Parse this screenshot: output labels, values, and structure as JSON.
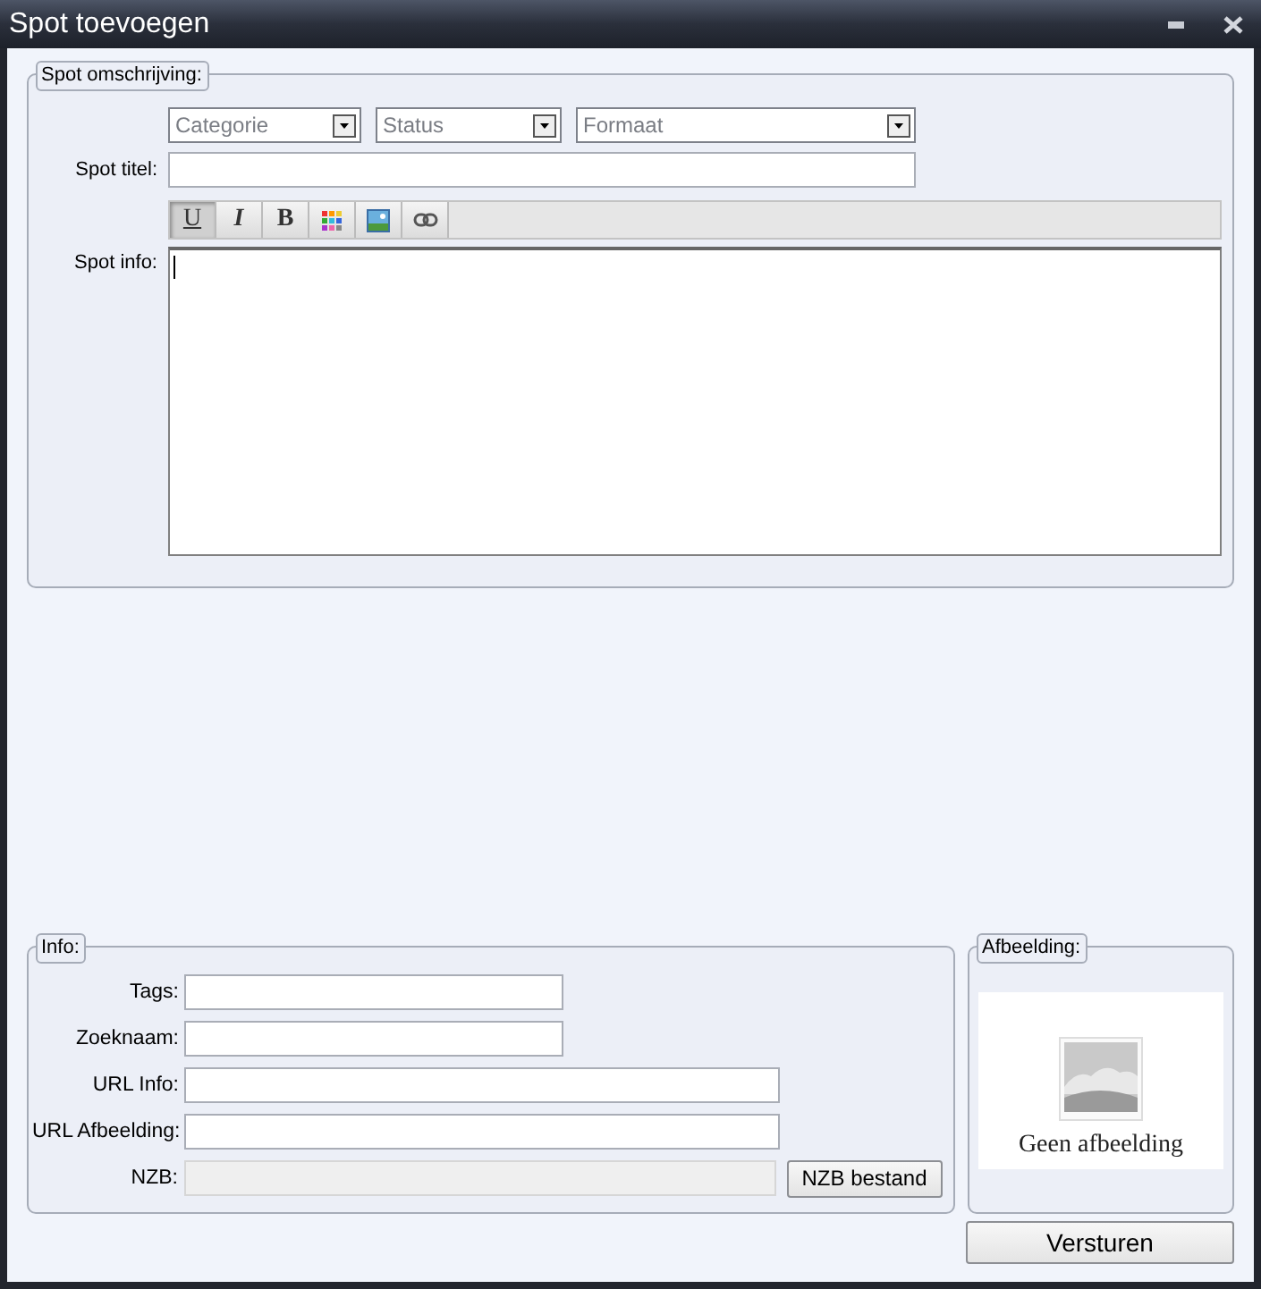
{
  "window": {
    "title": "Spot toevoegen"
  },
  "description": {
    "legend": "Spot omschrijving:",
    "dropdowns": [
      {
        "value": "Categorie"
      },
      {
        "value": "Status"
      },
      {
        "value": "Formaat"
      }
    ],
    "title_label": "Spot titel:",
    "toolbar": [
      {
        "kind": "underline",
        "label": "U",
        "selected": true
      },
      {
        "kind": "italic",
        "label": "I",
        "selected": false
      },
      {
        "kind": "bold",
        "label": "B",
        "selected": false
      },
      {
        "kind": "color"
      },
      {
        "kind": "image"
      },
      {
        "kind": "link"
      }
    ],
    "info_label": "Spot info:"
  },
  "info": {
    "legend": "Info:",
    "fields": [
      {
        "label": "Tags:",
        "disabled": false
      },
      {
        "label": "Zoeknaam:",
        "disabled": false
      },
      {
        "label": "URL Info:",
        "disabled": false
      },
      {
        "label": "URL Afbeelding:",
        "disabled": false
      },
      {
        "label": "NZB:",
        "disabled": true,
        "button": "NZB bestand"
      }
    ]
  },
  "image": {
    "legend": "Afbeelding:",
    "caption": "Geen afbeelding"
  },
  "submit": "Versturen"
}
